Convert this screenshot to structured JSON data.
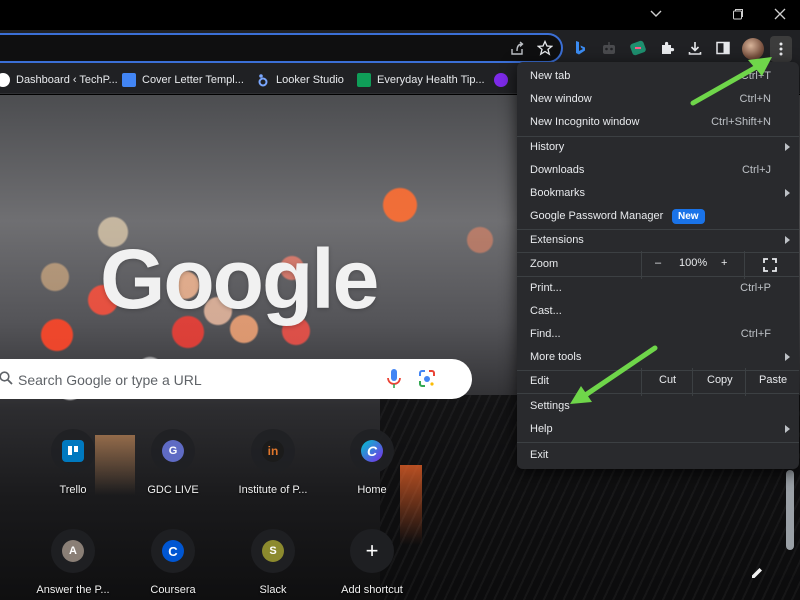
{
  "toolbar": {
    "icons": [
      "share-icon",
      "star-icon",
      "bing-icon",
      "extension-robot-icon",
      "extension-tag-icon",
      "extensions-puzzle-icon",
      "download-icon",
      "side-panel-icon",
      "profile-avatar",
      "menu-kebab-icon"
    ]
  },
  "bookmarks": [
    {
      "label": "Dashboard ‹ TechP...",
      "icon": "wordpress-icon",
      "color": "#ffffff"
    },
    {
      "label": "Cover Letter Templ...",
      "icon": "docs-icon",
      "color": "#4285f4"
    },
    {
      "label": "Looker Studio",
      "icon": "looker-icon",
      "color": "#7aa7ff"
    },
    {
      "label": "Everyday Health Tip...",
      "icon": "sheets-icon",
      "color": "#0f9d58"
    }
  ],
  "ntp": {
    "logo": "Google",
    "search_placeholder": "Search Google or type a URL",
    "shortcuts": [
      {
        "label": "Trello",
        "icon": "trello-icon",
        "color": "#0079bf",
        "glyph": ""
      },
      {
        "label": "GDC LIVE",
        "icon": "gdc-icon",
        "color": "#5f6bc4",
        "glyph": "G"
      },
      {
        "label": "Institute of P...",
        "icon": "institute-icon",
        "color": "#1b1b1b",
        "glyph": "in"
      },
      {
        "label": "Home",
        "icon": "canva-icon",
        "color": "#7d2ae8",
        "glyph": "C"
      },
      {
        "label": "Answer the P...",
        "icon": "answer-icon",
        "color": "#8a7f76",
        "glyph": "A"
      },
      {
        "label": "Coursera",
        "icon": "coursera-icon",
        "color": "#0056d2",
        "glyph": "C"
      },
      {
        "label": "Slack",
        "icon": "slack-icon",
        "color": "#8c8a2e",
        "glyph": "S"
      },
      {
        "label": "Add shortcut",
        "icon": "plus-icon",
        "color": "#202124",
        "glyph": "+"
      }
    ]
  },
  "menu": {
    "new_tab": {
      "label": "New tab",
      "shortcut": "Ctrl+T"
    },
    "new_window": {
      "label": "New window",
      "shortcut": "Ctrl+N"
    },
    "new_incognito": {
      "label": "New Incognito window",
      "shortcut": "Ctrl+Shift+N"
    },
    "history": {
      "label": "History"
    },
    "downloads": {
      "label": "Downloads",
      "shortcut": "Ctrl+J"
    },
    "bookmarks": {
      "label": "Bookmarks"
    },
    "password_manager": {
      "label": "Google Password Manager",
      "badge": "New"
    },
    "extensions": {
      "label": "Extensions"
    },
    "zoom": {
      "label": "Zoom",
      "minus": "–",
      "value": "100%",
      "plus": "+"
    },
    "print": {
      "label": "Print...",
      "shortcut": "Ctrl+P"
    },
    "cast": {
      "label": "Cast..."
    },
    "find": {
      "label": "Find...",
      "shortcut": "Ctrl+F"
    },
    "more_tools": {
      "label": "More tools"
    },
    "edit": {
      "label": "Edit",
      "cut": "Cut",
      "copy": "Copy",
      "paste": "Paste"
    },
    "settings": {
      "label": "Settings"
    },
    "help": {
      "label": "Help"
    },
    "exit": {
      "label": "Exit"
    }
  },
  "colors": {
    "annotation_arrow": "#6fd64a",
    "accent": "#1a73e8"
  }
}
